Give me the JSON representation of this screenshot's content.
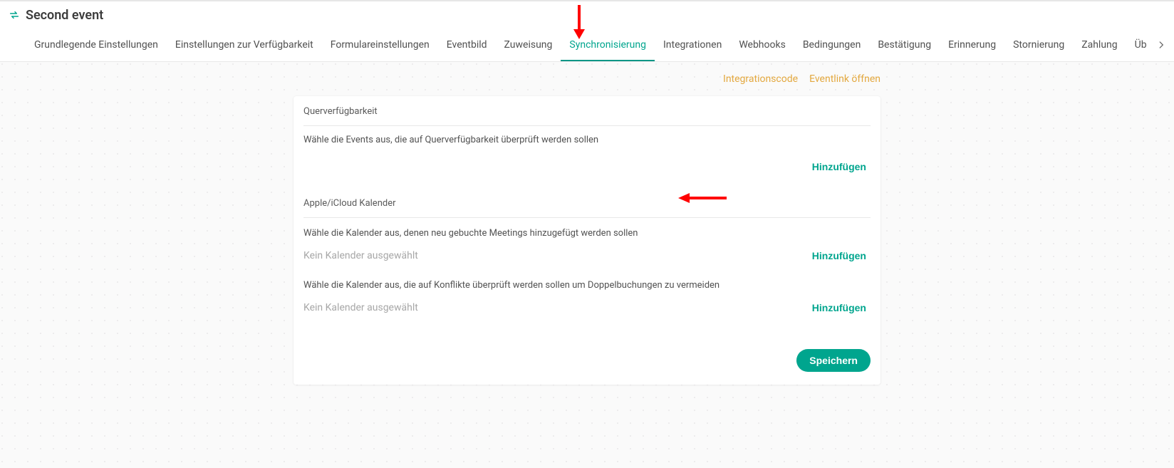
{
  "header": {
    "title": "Second event"
  },
  "tabs": {
    "items": [
      "Grundlegende Einstellungen",
      "Einstellungen zur Verfügbarkeit",
      "Formulareinstellungen",
      "Eventbild",
      "Zuweisung",
      "Synchronisierung",
      "Integrationen",
      "Webhooks",
      "Bedingungen",
      "Bestätigung",
      "Erinnerung",
      "Stornierung",
      "Zahlung",
      "Üb"
    ],
    "activeIndex": 5
  },
  "topLinks": {
    "integration": "Integrationscode",
    "openLink": "Eventlink öffnen"
  },
  "cross": {
    "title": "Querverfügbarkeit",
    "help": "Wähle die Events aus, die auf Querverfügbarkeit überprüft werden sollen",
    "addLabel": "Hinzufügen"
  },
  "apple": {
    "title": "Apple/iCloud Kalender",
    "help1": "Wähle die Kalender aus, denen neu gebuchte Meetings hinzugefügt werden sollen",
    "empty1": "Kein Kalender ausgewählt",
    "add1": "Hinzufügen",
    "help2": "Wähle die Kalender aus, die auf Konflikte überprüft werden sollen um Doppelbuchungen zu vermeiden",
    "empty2": "Kein Kalender ausgewählt",
    "add2": "Hinzufügen"
  },
  "save": {
    "label": "Speichern"
  },
  "colors": {
    "accent": "#00a58e",
    "amber": "#e3a83f"
  }
}
